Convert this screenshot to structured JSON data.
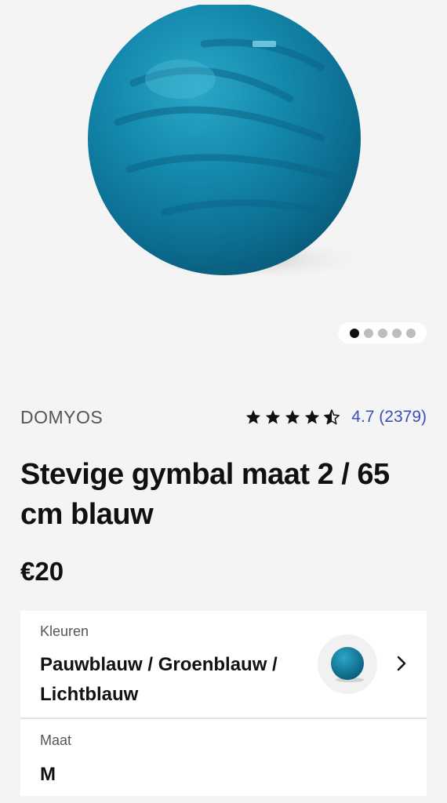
{
  "gallery": {
    "image_alt": "Blauwe gymbal",
    "dots": [
      true,
      false,
      false,
      false,
      false
    ]
  },
  "product": {
    "brand": "DOMYOS",
    "rating_value": 4.7,
    "rating_text": "4.7 (2379)",
    "title": "Stevige gymbal maat 2 / 65 cm blauw",
    "price": "€20"
  },
  "colors": {
    "label": "Kleuren",
    "value": "Pauwblauw / Groenblauw / Lichtblauw",
    "swatch": "#0f7fa5"
  },
  "size": {
    "label": "Maat",
    "value": "M"
  }
}
